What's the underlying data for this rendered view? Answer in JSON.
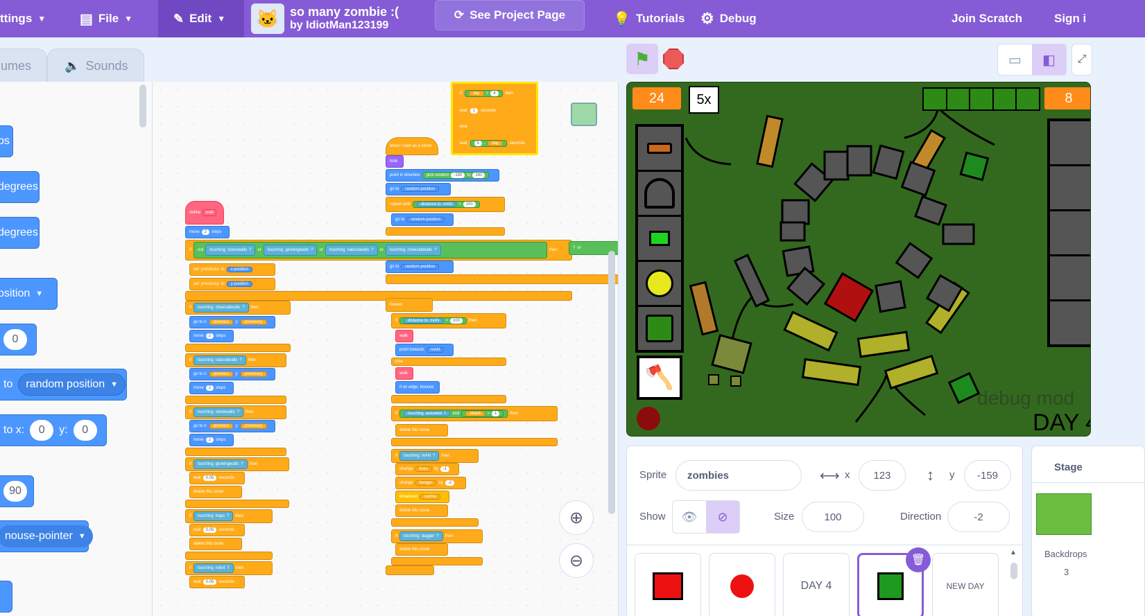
{
  "menubar": {
    "settings": "ttings",
    "file": "File",
    "edit": "Edit",
    "project_title": "so many zombie :(",
    "project_author": "by IdiotMan123199",
    "see_project": "See Project Page",
    "tutorials": "Tutorials",
    "debug": "Debug",
    "join": "Join Scratch",
    "sign_in": "Sign i"
  },
  "tabs": {
    "costumes": "umes",
    "sounds": "Sounds"
  },
  "palette": {
    "b1": "ps",
    "b2": "degrees",
    "b3": "degrees",
    "b4": "osition",
    "b5": "0",
    "b6_to": "to",
    "b6_dd": "random position",
    "b7_to": "to x:",
    "b7_x": "0",
    "b7_y_label": "y:",
    "b7_y": "0",
    "b8": "90",
    "b9": "nouse-pointer"
  },
  "scripts": {
    "define": "define",
    "walk": "walk",
    "move": "move",
    "steps": "steps",
    "two": "2",
    "if": "if",
    "not": "not",
    "touching": "touching",
    "stonewalls": "stonewalls",
    "glowingwalls": "glowingwalls",
    "naturalwalls": "naturalwalls",
    "cheezaltwalls": "cheezaltwalls",
    "or": "or",
    "q": "?",
    "then": "then",
    "set": "set",
    "previousx": "previousx",
    "previousy": "previousy",
    "to": "to",
    "xpos": "x position",
    "ypos": "y position",
    "gotox": "go to x:",
    "y": "y:",
    "previous": "previous",
    "previouxy": "previouxy",
    "traps": "traps",
    "robot": "robot",
    "wait": "wait",
    "w005": "0.05",
    "seconds": "seconds",
    "delete": "delete this clone",
    "clone_start": "when I start as a clone",
    "hide": "hide",
    "point_dir": "point in direction",
    "pick_random": "pick random",
    "neg180": "-180",
    "r180": "180",
    "goto": "go to",
    "random_pos": "random position",
    "repeat_until": "repeat until",
    "distance_to": "distance to",
    "man": "mAN",
    "gt": ">",
    "lt": "<",
    "hundred": "100",
    "forever": "forever",
    "point_towards": "point towards",
    "else": "else",
    "edge_bounce": "if on edge, bounce",
    "axewield": "axewield",
    "and": "and",
    "attack": "attack",
    "eq": "=",
    "one": "1",
    "change": "change",
    "lives": "lives",
    "hunger": "hunger",
    "by": "by",
    "neg1": "-1",
    "neg2": "-2",
    "broadcast": "broadcast",
    "ouchie": "ouchie",
    "dagger": "dagger",
    "day": "day",
    "four": "4",
    "five": "5",
    "minus": "-",
    "plus": "+"
  },
  "stage": {
    "counter_left": "24",
    "multiplier": "5x",
    "counter_right": "8",
    "debug_text": "debug mod",
    "day_text": "DAY 4"
  },
  "sprite": {
    "label": "Sprite",
    "name": "zombies",
    "x_label": "x",
    "x": "123",
    "y_label": "y",
    "y": "-159",
    "show_label": "Show",
    "size_label": "Size",
    "size": "100",
    "direction_label": "Direction",
    "direction": "-2"
  },
  "thumbs": [
    "DAY 4",
    "NEW DAY"
  ],
  "stagepane": {
    "title": "Stage",
    "backdrops_label": "Backdrops",
    "backdrops_count": "3"
  },
  "colors": {
    "menubar": "#855cd6",
    "motion": "#4c97ff",
    "control": "#ffab19",
    "operators": "#59c059",
    "sensing": "#5cb1d6",
    "myblocks": "#ff6680",
    "looks": "#9966ff",
    "stage_bg": "#33691e"
  }
}
